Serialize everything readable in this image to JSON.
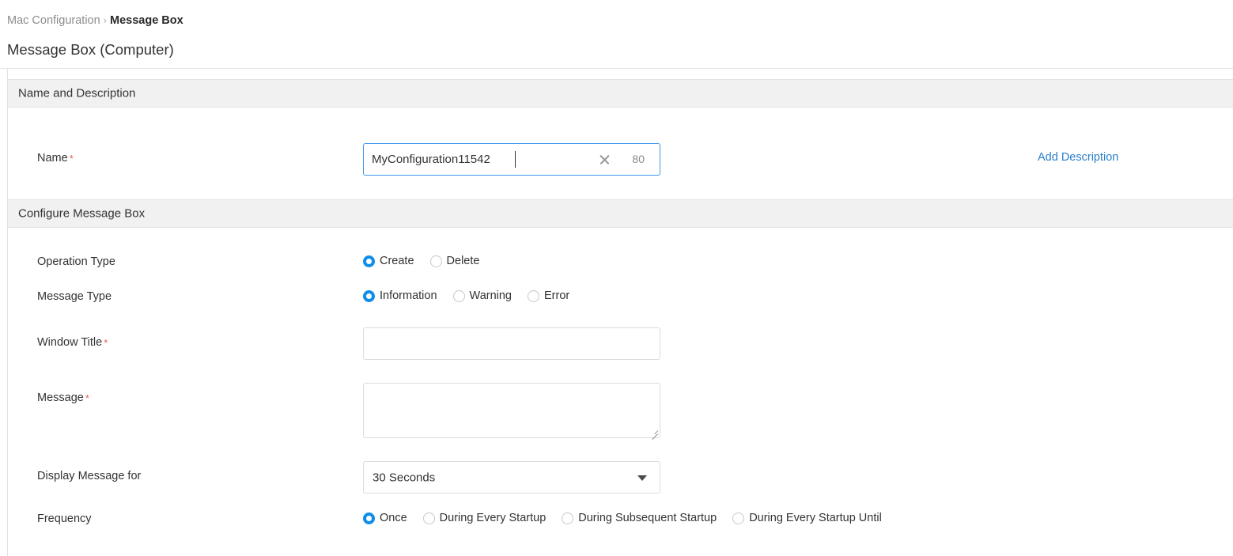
{
  "breadcrumb": {
    "parent": "Mac Configuration",
    "separator": "›",
    "current": "Message Box"
  },
  "page_title": "Message Box (Computer)",
  "colors": {
    "accent_blue": "#0f8ee9",
    "link_blue": "#2a7fc9",
    "focus_border": "#3c97e8",
    "required_red": "#e8604c",
    "section_bg": "#f1f1f1"
  },
  "sections": {
    "name_and_description": {
      "title": "Name and Description",
      "name_row": {
        "label": "Name",
        "required_mark": "*",
        "value": "MyConfiguration11542",
        "placeholder": "",
        "clear_icon": "close-icon",
        "char_count": "80",
        "add_description_link": "Add Description"
      }
    },
    "configure_message_box": {
      "title": "Configure Message Box",
      "operation_type": {
        "label": "Operation Type",
        "options": [
          "Create",
          "Delete"
        ],
        "selected": "Create"
      },
      "message_type": {
        "label": "Message Type",
        "options": [
          "Information",
          "Warning",
          "Error"
        ],
        "selected": "Information"
      },
      "window_title": {
        "label": "Window Title",
        "required_mark": "*",
        "value": "",
        "placeholder": ""
      },
      "message": {
        "label": "Message",
        "required_mark": "*",
        "value": "",
        "placeholder": ""
      },
      "display_message_for": {
        "label": "Display Message for",
        "selected": "30 Seconds",
        "chevron_icon": "chevron-down-icon"
      },
      "frequency": {
        "label": "Frequency",
        "options": [
          "Once",
          "During Every Startup",
          "During Subsequent Startup",
          "During Every Startup Until"
        ],
        "selected": "Once"
      }
    }
  }
}
